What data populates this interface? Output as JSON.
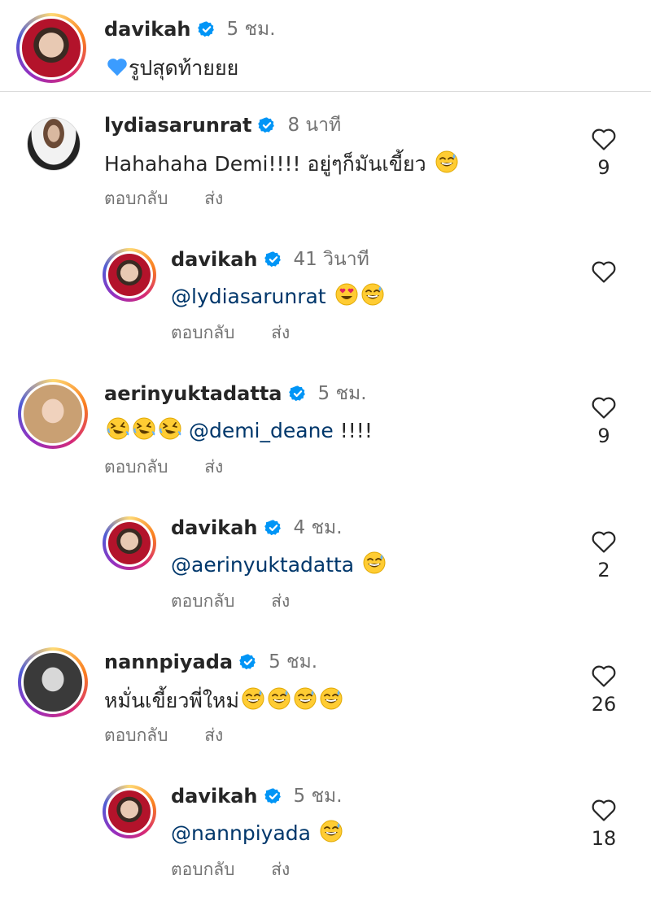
{
  "caption": {
    "username": "davikah",
    "time": "5 ชม.",
    "text": "รูปสุดท้ายยย",
    "emoji_prefix": "blue-heart-emoji"
  },
  "comments": [
    {
      "username": "lydiasarunrat",
      "time": "8 นาที",
      "text": "Hahahaha Demi!!!! อยู่ๆก็มันเขี้ยว",
      "emojis": [
        "grinning-sweat-emoji"
      ],
      "reply_label": "ตอบกลับ",
      "send_label": "ส่ง",
      "likes": "9"
    },
    {
      "username": "davikah",
      "time": "41 วินาที",
      "mention": "@lydiasarunrat",
      "emojis": [
        "heart-eyes-emoji",
        "grinning-sweat-emoji"
      ],
      "reply_label": "ตอบกลับ",
      "send_label": "ส่ง",
      "likes": ""
    },
    {
      "username": "aerinyuktadatta",
      "time": "5 ชม.",
      "mention": "@demi_deane",
      "text_after": " !!!!",
      "emojis_before": [
        "rofl-emoji",
        "rofl-emoji",
        "rofl-emoji"
      ],
      "reply_label": "ตอบกลับ",
      "send_label": "ส่ง",
      "likes": "9"
    },
    {
      "username": "davikah",
      "time": "4 ชม.",
      "mention": "@aerinyuktadatta",
      "emojis": [
        "grinning-sweat-emoji"
      ],
      "reply_label": "ตอบกลับ",
      "send_label": "ส่ง",
      "likes": "2"
    },
    {
      "username": "nannpiyada",
      "time": "5 ชม.",
      "text": "หมั่นเขี้ยวพี่ใหม่",
      "emojis": [
        "grinning-sweat-emoji",
        "grinning-sweat-emoji",
        "grinning-sweat-emoji",
        "grinning-sweat-emoji"
      ],
      "reply_label": "ตอบกลับ",
      "send_label": "ส่ง",
      "likes": "26"
    },
    {
      "username": "davikah",
      "time": "5 ชม.",
      "mention": "@nannpiyada",
      "emojis": [
        "grinning-sweat-emoji"
      ],
      "reply_label": "ตอบกลับ",
      "send_label": "ส่ง",
      "likes": "18"
    }
  ],
  "colors": {
    "verified_blue": "#0095f6",
    "mention": "#00376b",
    "secondary_text": "#737373",
    "emoji_yellow": "#ffcc33"
  }
}
